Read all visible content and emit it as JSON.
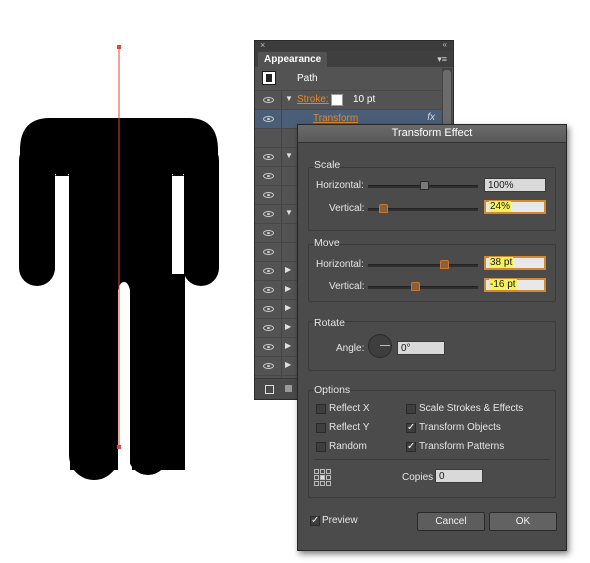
{
  "appearance_panel": {
    "tab_title": "Appearance",
    "close_glyph": "×",
    "collapse_glyph": "«",
    "menu_glyph": "▾≡",
    "path_label": "Path",
    "stroke_label": "Stroke:",
    "stroke_weight": "10 pt",
    "transform_label": "Transform",
    "fx_label": "fx"
  },
  "dialog": {
    "title": "Transform Effect",
    "scale": {
      "title": "Scale",
      "horizontal_label": "Horizontal:",
      "horizontal_value": "100%",
      "vertical_label": "Vertical:",
      "vertical_value": "24%"
    },
    "move": {
      "title": "Move",
      "horizontal_label": "Horizontal:",
      "horizontal_value": "38 pt",
      "vertical_label": "Vertical:",
      "vertical_value": "-16 pt"
    },
    "rotate": {
      "title": "Rotate",
      "angle_label": "Angle:",
      "angle_value": "0°"
    },
    "options": {
      "title": "Options",
      "reflect_x": "Reflect X",
      "reflect_y": "Reflect Y",
      "random": "Random",
      "scale_strokes": "Scale Strokes & Effects",
      "transform_objects": "Transform Objects",
      "transform_patterns": "Transform Patterns",
      "reflect_x_checked": false,
      "reflect_y_checked": false,
      "random_checked": false,
      "scale_strokes_checked": false,
      "transform_objects_checked": true,
      "transform_patterns_checked": true
    },
    "copies_label": "Copies",
    "copies_value": "0",
    "preview_label": "Preview",
    "preview_checked": true,
    "cancel_label": "Cancel",
    "ok_label": "OK",
    "check_glyph": "✓"
  },
  "colors": {
    "selection_line": "#e0453a",
    "accent_orange": "#d08a33",
    "field_highlight": "#f6f25a"
  }
}
